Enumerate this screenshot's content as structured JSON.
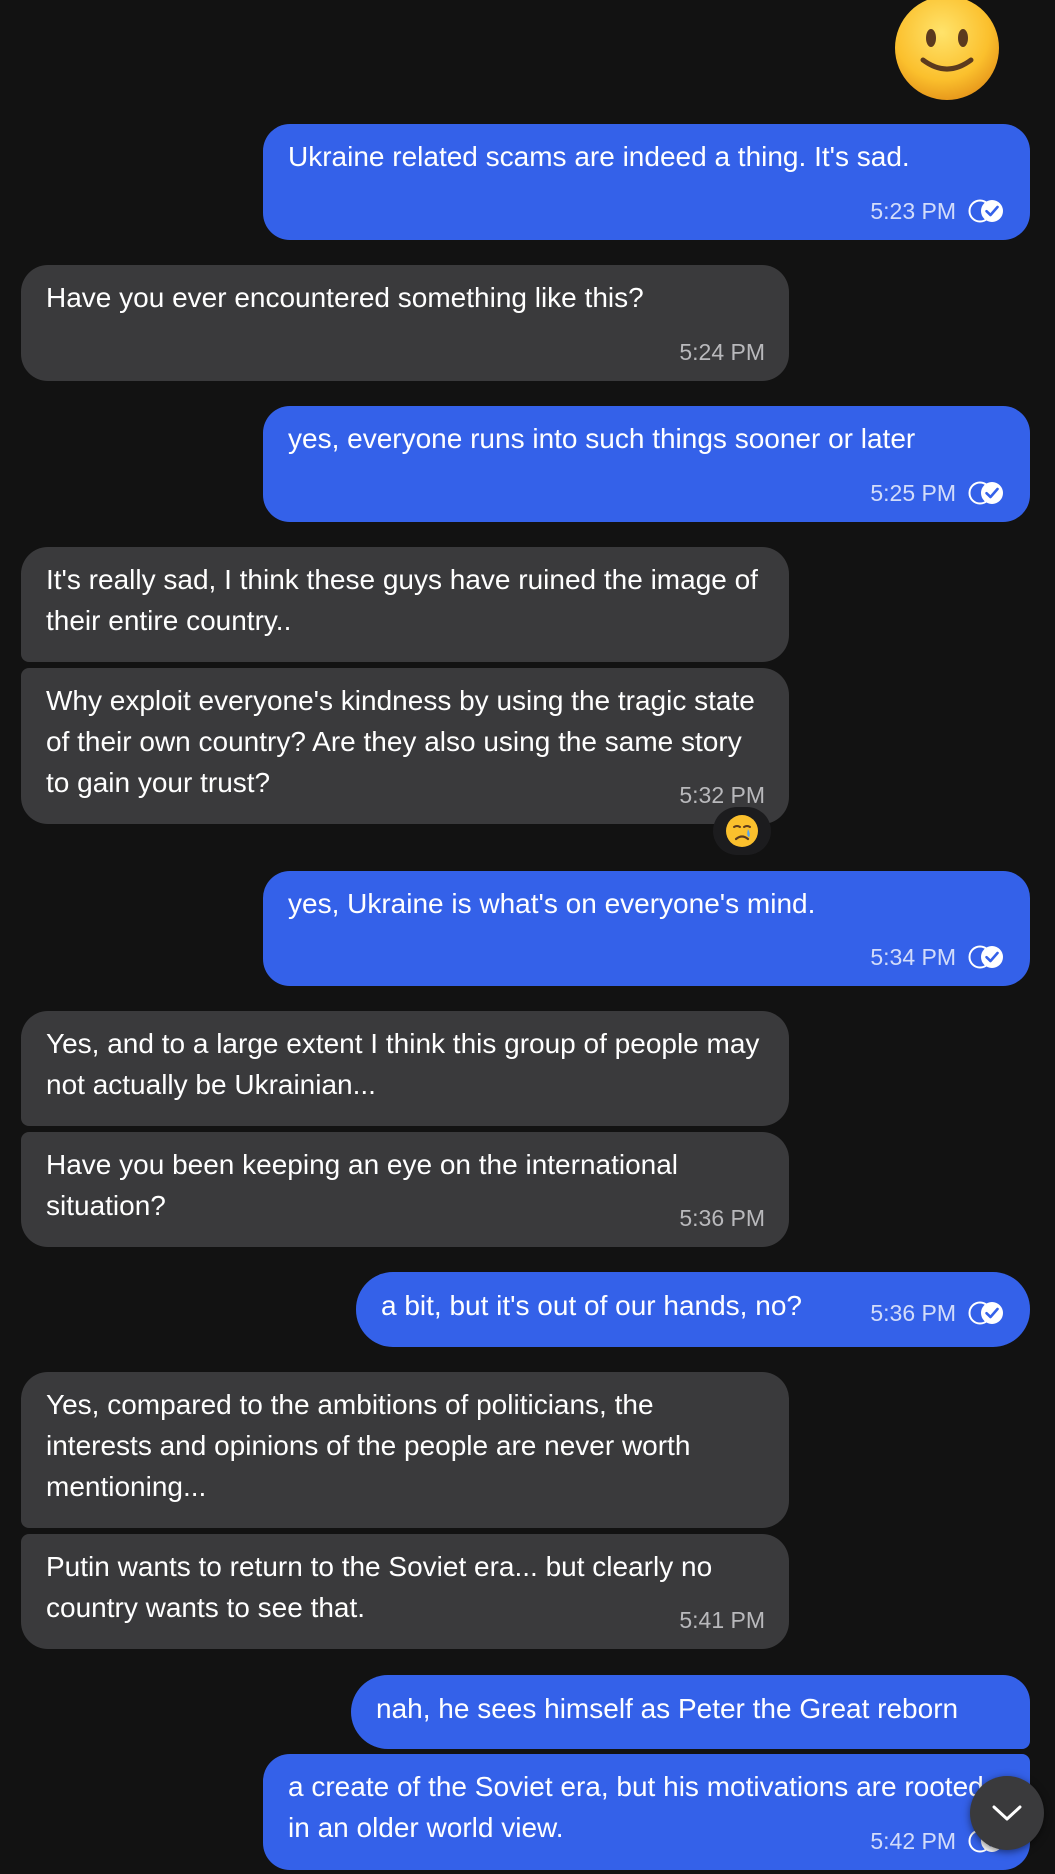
{
  "top_emoji": "slightly-smiling-face",
  "colors": {
    "background": "#121212",
    "incoming_bubble": "#3a3a3c",
    "outgoing_bubble": "#3461e9"
  },
  "messages": [
    {
      "direction": "out",
      "text": "Ukraine related scams are indeed a thing. It's sad.",
      "time": "5:23 PM",
      "read": true
    },
    {
      "direction": "in",
      "text": "Have you ever encountered something like this?",
      "time": "5:24 PM"
    },
    {
      "direction": "out",
      "text": "yes, everyone runs into such things sooner or later",
      "time": "5:25 PM",
      "read": true
    },
    {
      "direction": "in",
      "text": "It's really sad, I think these guys have ruined the image of their entire country.."
    },
    {
      "direction": "in",
      "text": "Why exploit everyone's kindness by using the tragic state of their own country? Are they also using the same story to gain your trust?",
      "time": "5:32 PM",
      "reaction": "crying-face"
    },
    {
      "direction": "out",
      "text": "yes, Ukraine is what's on everyone's mind.",
      "time": "5:34 PM",
      "read": true
    },
    {
      "direction": "in",
      "text": "Yes, and to a large extent I think this group of people may not actually be Ukrainian..."
    },
    {
      "direction": "in",
      "text": "Have you been keeping an eye on the international situation?",
      "time": "5:36 PM"
    },
    {
      "direction": "out",
      "text": "a bit, but it's out of our hands, no?",
      "time": "5:36 PM",
      "read": true
    },
    {
      "direction": "in",
      "text": "Yes, compared to the ambitions of politicians, the interests and opinions of the people are never worth mentioning..."
    },
    {
      "direction": "in",
      "text": "Putin wants to return to the Soviet era... but clearly no country wants to see that.",
      "time": "5:41 PM"
    },
    {
      "direction": "out",
      "text": "nah, he sees himself as Peter the Great reborn"
    },
    {
      "direction": "out",
      "text": "a create of the Soviet era, but his motivations are rooted in an older world view.",
      "time": "5:42 PM",
      "read": true
    }
  ],
  "scroll_button_icon": "chevron-down-icon"
}
